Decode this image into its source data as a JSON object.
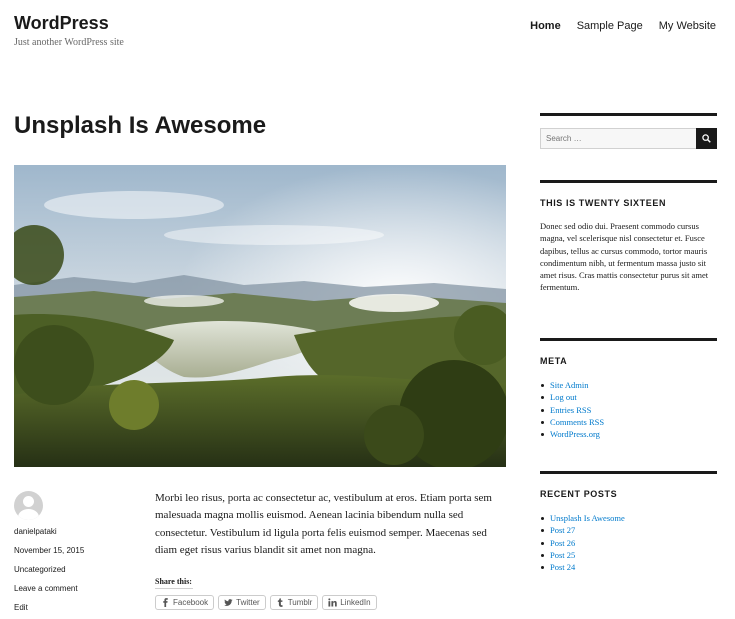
{
  "site": {
    "title": "WordPress",
    "tagline": "Just another WordPress site"
  },
  "nav": [
    "Home",
    "Sample Page",
    "My Website"
  ],
  "post": {
    "title": "Unsplash Is Awesome",
    "author": "danielpataki",
    "date": "November 15, 2015",
    "category": "Uncategorized",
    "comment_link": "Leave a comment",
    "edit_link": "Edit",
    "content": "Morbi leo risus, porta ac consectetur ac, vestibulum at eros. Etiam porta sem malesuada magna mollis euismod. Aenean lacinia bibendum nulla sed consectetur. Vestibulum id ligula porta felis euismod semper. Maecenas sed diam eget risus varius blandit sit amet non magna.",
    "share_title": "Share this:",
    "share_buttons": [
      "Facebook",
      "Twitter",
      "Tumblr",
      "LinkedIn"
    ]
  },
  "sidebar": {
    "search_placeholder": "Search …",
    "text_title": "THIS IS TWENTY SIXTEEN",
    "text_body": "Donec sed odio dui. Praesent commodo cursus magna, vel scelerisque nisl consectetur et. Fusce dapibus, tellus ac cursus commodo, tortor mauris condimentum nibh, ut fermentum massa justo sit amet risus. Cras mattis consectetur purus sit amet fermentum.",
    "meta_title": "META",
    "meta_links": [
      "Site Admin",
      "Log out",
      "Entries RSS",
      "Comments RSS",
      "WordPress.org"
    ],
    "recent_title": "RECENT POSTS",
    "recent_posts": [
      "Unsplash Is Awesome",
      "Post 27",
      "Post 26",
      "Post 25",
      "Post 24"
    ]
  },
  "colors": {
    "link": "#007acc",
    "text": "#1a1a1a",
    "muted": "#686868",
    "border": "#d1d1d1"
  }
}
